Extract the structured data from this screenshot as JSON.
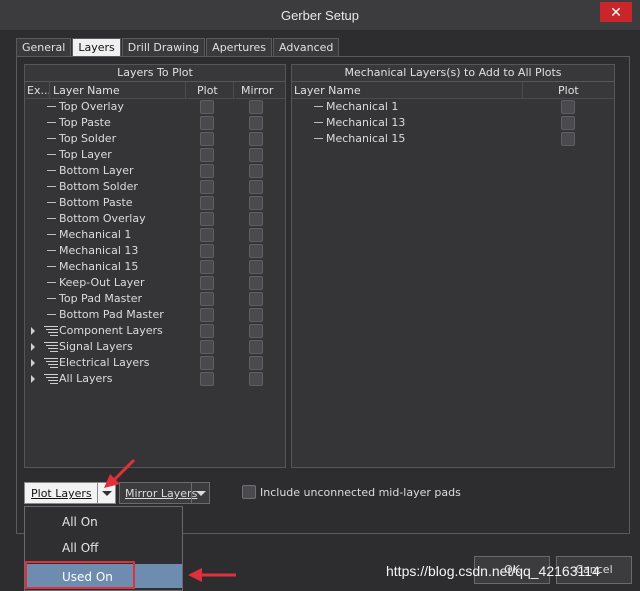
{
  "window": {
    "title": "Gerber Setup",
    "close_glyph": "✕"
  },
  "tabs": [
    {
      "label": "General"
    },
    {
      "label": "Layers",
      "active": true
    },
    {
      "label": "Drill Drawing"
    },
    {
      "label": "Apertures"
    },
    {
      "label": "Advanced"
    }
  ],
  "layers_to_plot": {
    "title": "Layers To Plot",
    "columns": {
      "expand": "Ex...",
      "name": "Layer Name",
      "plot": "Plot",
      "mirror": "Mirror"
    },
    "rows": [
      {
        "name": "Top Overlay",
        "group": false
      },
      {
        "name": "Top Paste",
        "group": false
      },
      {
        "name": "Top Solder",
        "group": false
      },
      {
        "name": "Top Layer",
        "group": false
      },
      {
        "name": "Bottom Layer",
        "group": false
      },
      {
        "name": "Bottom Solder",
        "group": false
      },
      {
        "name": "Bottom Paste",
        "group": false
      },
      {
        "name": "Bottom Overlay",
        "group": false
      },
      {
        "name": "Mechanical 1",
        "group": false
      },
      {
        "name": "Mechanical 13",
        "group": false
      },
      {
        "name": "Mechanical 15",
        "group": false
      },
      {
        "name": "Keep-Out Layer",
        "group": false
      },
      {
        "name": "Top Pad Master",
        "group": false
      },
      {
        "name": "Bottom Pad Master",
        "group": false
      },
      {
        "name": "Component Layers",
        "group": true
      },
      {
        "name": "Signal Layers",
        "group": true
      },
      {
        "name": "Electrical Layers",
        "group": true
      },
      {
        "name": "All Layers",
        "group": true
      }
    ]
  },
  "mechanical_layers": {
    "title": "Mechanical Layers(s) to Add to All Plots",
    "columns": {
      "name": "Layer Name",
      "plot": "Plot"
    },
    "rows": [
      {
        "name": "Mechanical 1"
      },
      {
        "name": "Mechanical 13"
      },
      {
        "name": "Mechanical 15"
      }
    ]
  },
  "controls": {
    "plot_layers": "Plot Layers",
    "mirror_layers": "Mirror Layers",
    "include_unconnected": "Include unconnected mid-layer pads"
  },
  "plot_menu": {
    "items": [
      {
        "label": "All On"
      },
      {
        "label": "All Off"
      },
      {
        "label": "Used On",
        "hovered": true
      }
    ]
  },
  "buttons": {
    "ok": "OK",
    "cancel": "Cancel"
  },
  "watermark": "https://blog.csdn.net/qq_42163114",
  "colors": {
    "accent": "#6e8bb0",
    "annotation": "#e0303a",
    "close": "#c8262b"
  }
}
